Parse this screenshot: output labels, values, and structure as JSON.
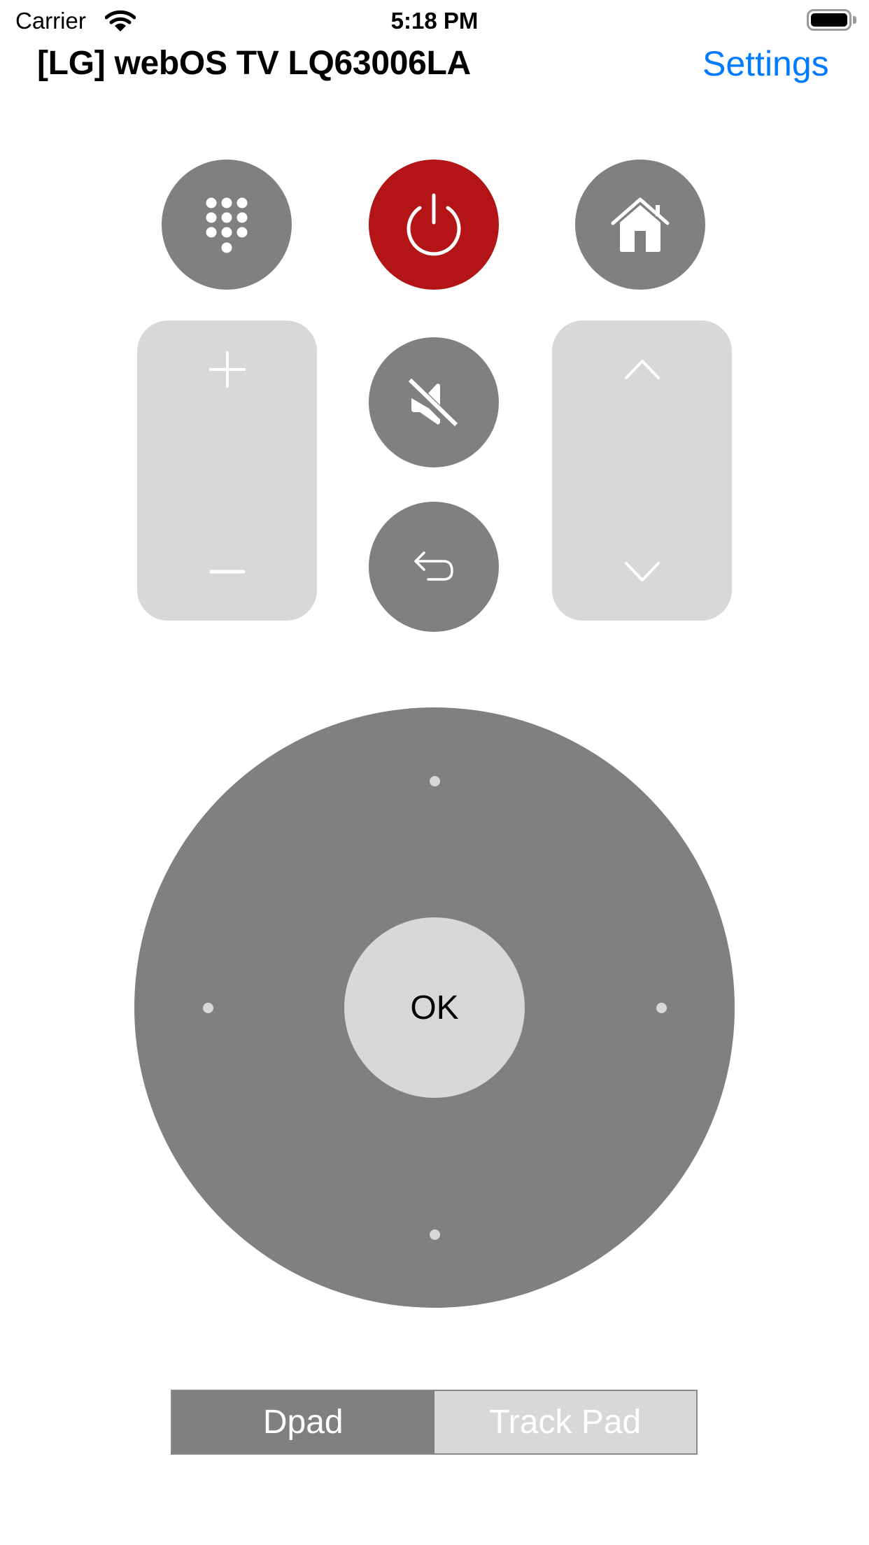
{
  "status_bar": {
    "carrier": "Carrier",
    "time": "5:18 PM",
    "wifi_icon": "wifi-icon",
    "battery_icon": "battery-full-icon"
  },
  "header": {
    "title": "[LG] webOS TV LQ63006LA",
    "settings_label": "Settings"
  },
  "top_buttons": [
    {
      "name": "keypad",
      "icon": "keypad-icon"
    },
    {
      "name": "power",
      "icon": "power-icon"
    },
    {
      "name": "home",
      "icon": "home-icon"
    }
  ],
  "volume": {
    "up_icon": "plus-icon",
    "down_icon": "minus-icon"
  },
  "center_buttons": [
    {
      "name": "mute",
      "icon": "speaker-muted-icon"
    },
    {
      "name": "back",
      "icon": "return-arrow-icon"
    }
  ],
  "channel": {
    "up_icon": "chevron-up-icon",
    "down_icon": "chevron-down-icon"
  },
  "dpad": {
    "ok_label": "OK",
    "direction_markers": [
      "up",
      "left",
      "right",
      "down"
    ]
  },
  "mode_selector": {
    "options": [
      "Dpad",
      "Track Pad"
    ],
    "selected": "Dpad"
  },
  "colors": {
    "accent": "#007AFF",
    "power": "#B31516",
    "button": "#808080",
    "pill": "#D8D8D8"
  }
}
